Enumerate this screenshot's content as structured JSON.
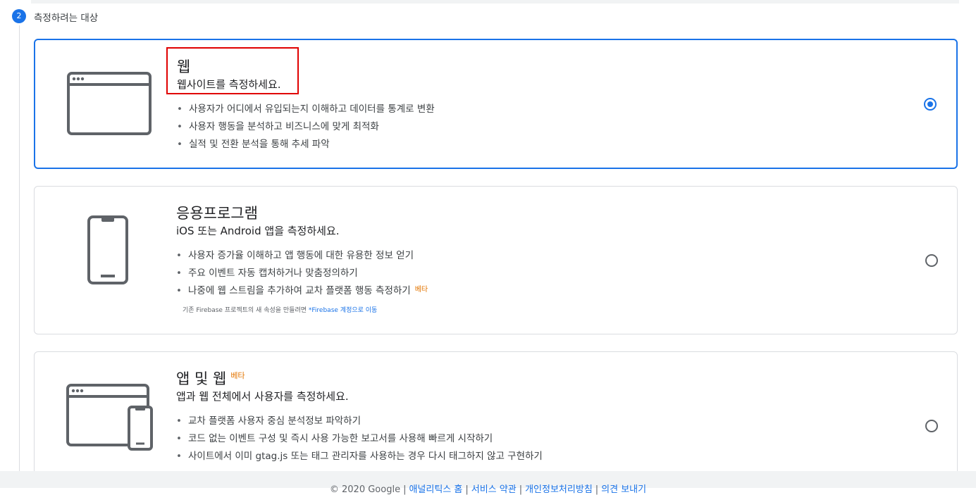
{
  "step": {
    "number": "2",
    "title": "측정하려는 대상"
  },
  "cards": [
    {
      "title": "웹",
      "subtitle": "웹사이트를 측정하세요.",
      "bullets": [
        "사용자가 어디에서 유입되는지 이해하고 데이터를 통계로 변환",
        "사용자 행동을 분석하고 비즈니스에 맞게 최적화",
        "실적 및 전환 분석을 통해 추세 파악"
      ],
      "selected": true
    },
    {
      "title": "응용프로그램",
      "subtitle": "iOS 또는 Android 앱을 측정하세요.",
      "bullets": [
        "사용자 증가율 이해하고 앱 행동에 대한 유용한 정보 얻기",
        "주요 이벤트 자동 캡처하거나 맞춤정의하기",
        "나중에 웹 스트림을 추가하여 교차 플랫폼 행동 측정하기"
      ],
      "beta": "베타",
      "note": "기존 Firebase 프로젝트의 새 속성을 만들려면",
      "note_link": "*Firebase 계정으로 이동",
      "selected": false
    },
    {
      "title": "앱 및 웹",
      "title_beta": "베타",
      "subtitle": "앱과 웹 전체에서 사용자를 측정하세요.",
      "bullets": [
        "교차 플랫폼 사용자 중심 분석정보 파악하기",
        "코드 없는 이벤트 구성 및 즉시 사용 가능한 보고서를 사용해 빠르게 시작하기",
        "사이트에서 이미 gtag.js 또는 태그 관리자를 사용하는 경우 다시 태그하지 않고 구현하기"
      ],
      "selected": false
    }
  ],
  "footer": {
    "copyright": "© 2020 Google",
    "links": [
      "애널리틱스 홈",
      "서비스 약관",
      "개인정보처리방침",
      "의견 보내기"
    ]
  },
  "colors": {
    "accent": "#1a73e8",
    "beta": "#e37400",
    "highlight": "#e00000"
  }
}
